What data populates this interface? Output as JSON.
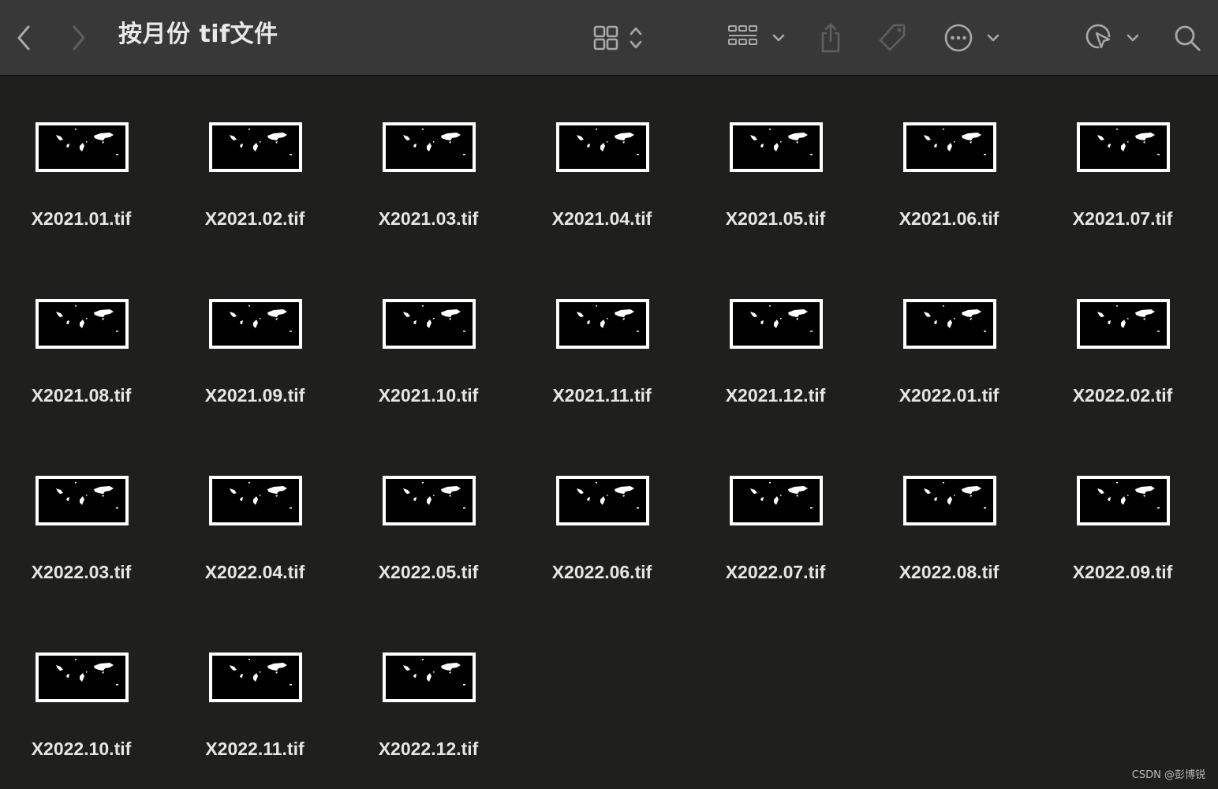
{
  "window": {
    "title": "按月份 tif文件"
  },
  "toolbar": {
    "icons": [
      "chevron-left-icon",
      "chevron-right-icon",
      "grid-view-icon",
      "up-down-chevron-icon",
      "group-icon",
      "chevron-down-icon",
      "share-icon",
      "tag-icon",
      "more-icon",
      "chevron-down-icon",
      "markup-icon",
      "chevron-down-icon",
      "search-icon"
    ],
    "icon_color": "#a8a8a8",
    "disabled_icon_color": "#5f5f5f"
  },
  "files": [
    {
      "name": "X2021.01.tif"
    },
    {
      "name": "X2021.02.tif"
    },
    {
      "name": "X2021.03.tif"
    },
    {
      "name": "X2021.04.tif"
    },
    {
      "name": "X2021.05.tif"
    },
    {
      "name": "X2021.06.tif"
    },
    {
      "name": "X2021.07.tif"
    },
    {
      "name": "X2021.08.tif"
    },
    {
      "name": "X2021.09.tif"
    },
    {
      "name": "X2021.10.tif"
    },
    {
      "name": "X2021.11.tif"
    },
    {
      "name": "X2021.12.tif"
    },
    {
      "name": "X2022.01.tif"
    },
    {
      "name": "X2022.02.tif"
    },
    {
      "name": "X2022.03.tif"
    },
    {
      "name": "X2022.04.tif"
    },
    {
      "name": "X2022.05.tif"
    },
    {
      "name": "X2022.06.tif"
    },
    {
      "name": "X2022.07.tif"
    },
    {
      "name": "X2022.08.tif"
    },
    {
      "name": "X2022.09.tif"
    },
    {
      "name": "X2022.10.tif"
    },
    {
      "name": "X2022.11.tif"
    },
    {
      "name": "X2022.12.tif"
    }
  ],
  "watermark": "CSDN @彭博锐",
  "colors": {
    "background": "#1f1f1d",
    "toolbar": "#383838",
    "label": "#e6e6e6"
  }
}
